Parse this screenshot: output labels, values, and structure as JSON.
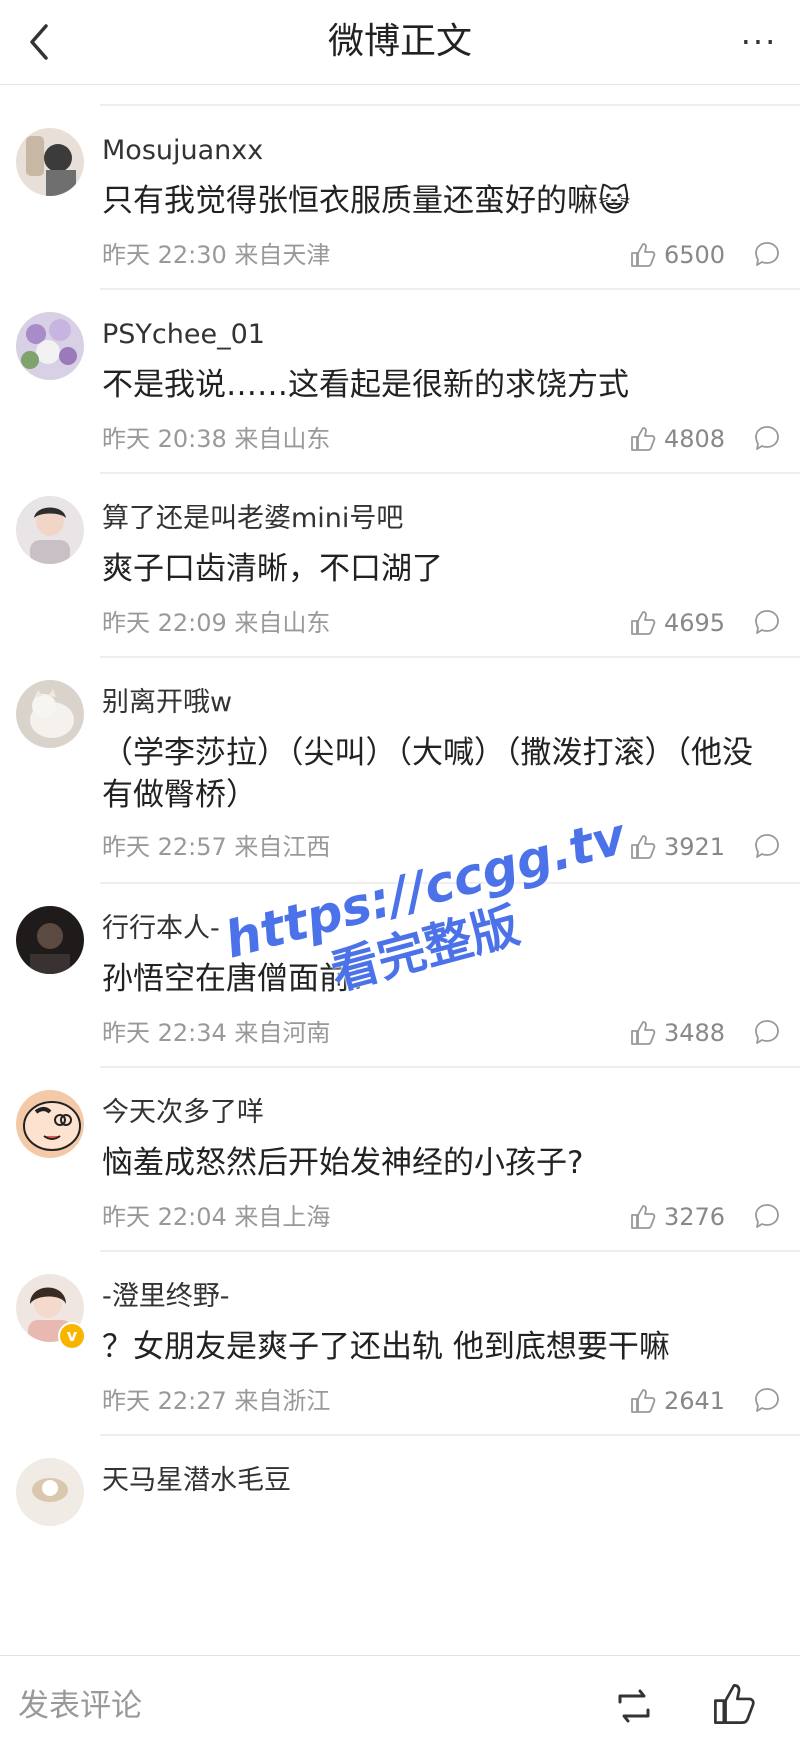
{
  "header": {
    "title": "微博正文",
    "more_label": "···"
  },
  "comments": [
    {
      "username": "Mosujuanxx",
      "text": "只有我觉得张恒衣服质量还蛮好的嘛",
      "emoji": "😺",
      "time": "昨天 22:30 来自天津",
      "likes": "6500",
      "avatar_icon": "avatar-photo"
    },
    {
      "username": "PSYchee_01",
      "text": "不是我说……这看起是很新的求饶方式",
      "time": "昨天 20:38 来自山东",
      "likes": "4808",
      "avatar_icon": "avatar-flowers"
    },
    {
      "username": "算了还是叫老婆mini号吧",
      "text": "爽子口齿清晰，不口湖了",
      "time": "昨天 22:09 来自山东",
      "likes": "4695",
      "avatar_icon": "avatar-girl"
    },
    {
      "username": "别离开哦w",
      "text": "（学李莎拉）（尖叫）（大喊）（撒泼打滚）（他没有做臀桥）",
      "time": "昨天 22:57 来自江西",
      "likes": "3921",
      "avatar_icon": "avatar-cat"
    },
    {
      "username": "行行本人-",
      "text": "孙悟空在唐僧面前：",
      "time": "昨天 22:34 来自河南",
      "likes": "3488",
      "avatar_icon": "avatar-dark"
    },
    {
      "username": "今天次多了咩",
      "text": "恼羞成怒然后开始发神经的小孩子?",
      "time": "昨天 22:04 来自上海",
      "likes": "3276",
      "avatar_icon": "avatar-cartoon"
    },
    {
      "username": "-澄里终野-",
      "text": "？女朋友是爽子了还出轨 他到底想要干嘛",
      "time": "昨天 22:27 来自浙江",
      "likes": "2641",
      "avatar_icon": "avatar-woman",
      "verified_badge": "v"
    },
    {
      "username": "天马星潜水毛豆",
      "avatar_icon": "avatar-cup"
    }
  ],
  "watermark": {
    "line1": "https://ccgg.tv",
    "line2": "看完整版"
  },
  "bottom_bar": {
    "comment_placeholder": "发表评论",
    "repost_icon": "repost-icon",
    "like_icon": "thumbs-up-icon"
  },
  "colors": {
    "watermark": "#4b72e8",
    "meta_text": "#999999",
    "verified_badge": "#f7b500"
  }
}
